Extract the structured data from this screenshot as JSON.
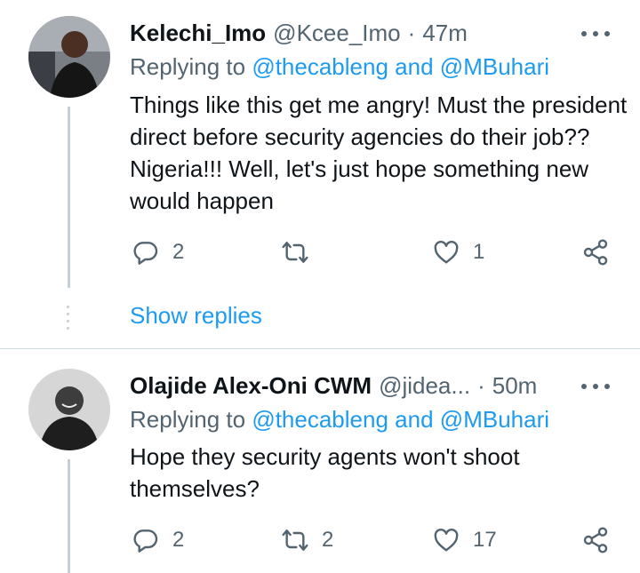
{
  "tweets": [
    {
      "name": "Kelechi_Imo",
      "handle": "@Kcee_Imo",
      "separator": "·",
      "time": "47m",
      "replying_prefix": "Replying to",
      "mention1": "@thecableng",
      "and_word": "and",
      "mention2": "@MBuhari",
      "text": "Things like this get me angry! Must the president direct before security agencies do their job?? Nigeria!!! Well, let's just hope something new would happen",
      "replies": "2",
      "retweets": "",
      "likes": "1"
    },
    {
      "name": "Olajide Alex-Oni CWM",
      "handle": "@jidea...",
      "separator": "·",
      "time": "50m",
      "replying_prefix": "Replying to",
      "mention1": "@thecableng",
      "and_word": "and",
      "mention2": "@MBuhari",
      "text": "Hope they security agents won't shoot themselves?",
      "replies": "2",
      "retweets": "2",
      "likes": "17"
    }
  ],
  "show_replies": "Show replies",
  "colors": {
    "accent": "#1d9bf0",
    "secondary": "#536471",
    "line": "#c4cfd6"
  },
  "icons": [
    "more-icon",
    "reply-icon",
    "retweet-icon",
    "like-icon",
    "share-icon"
  ]
}
